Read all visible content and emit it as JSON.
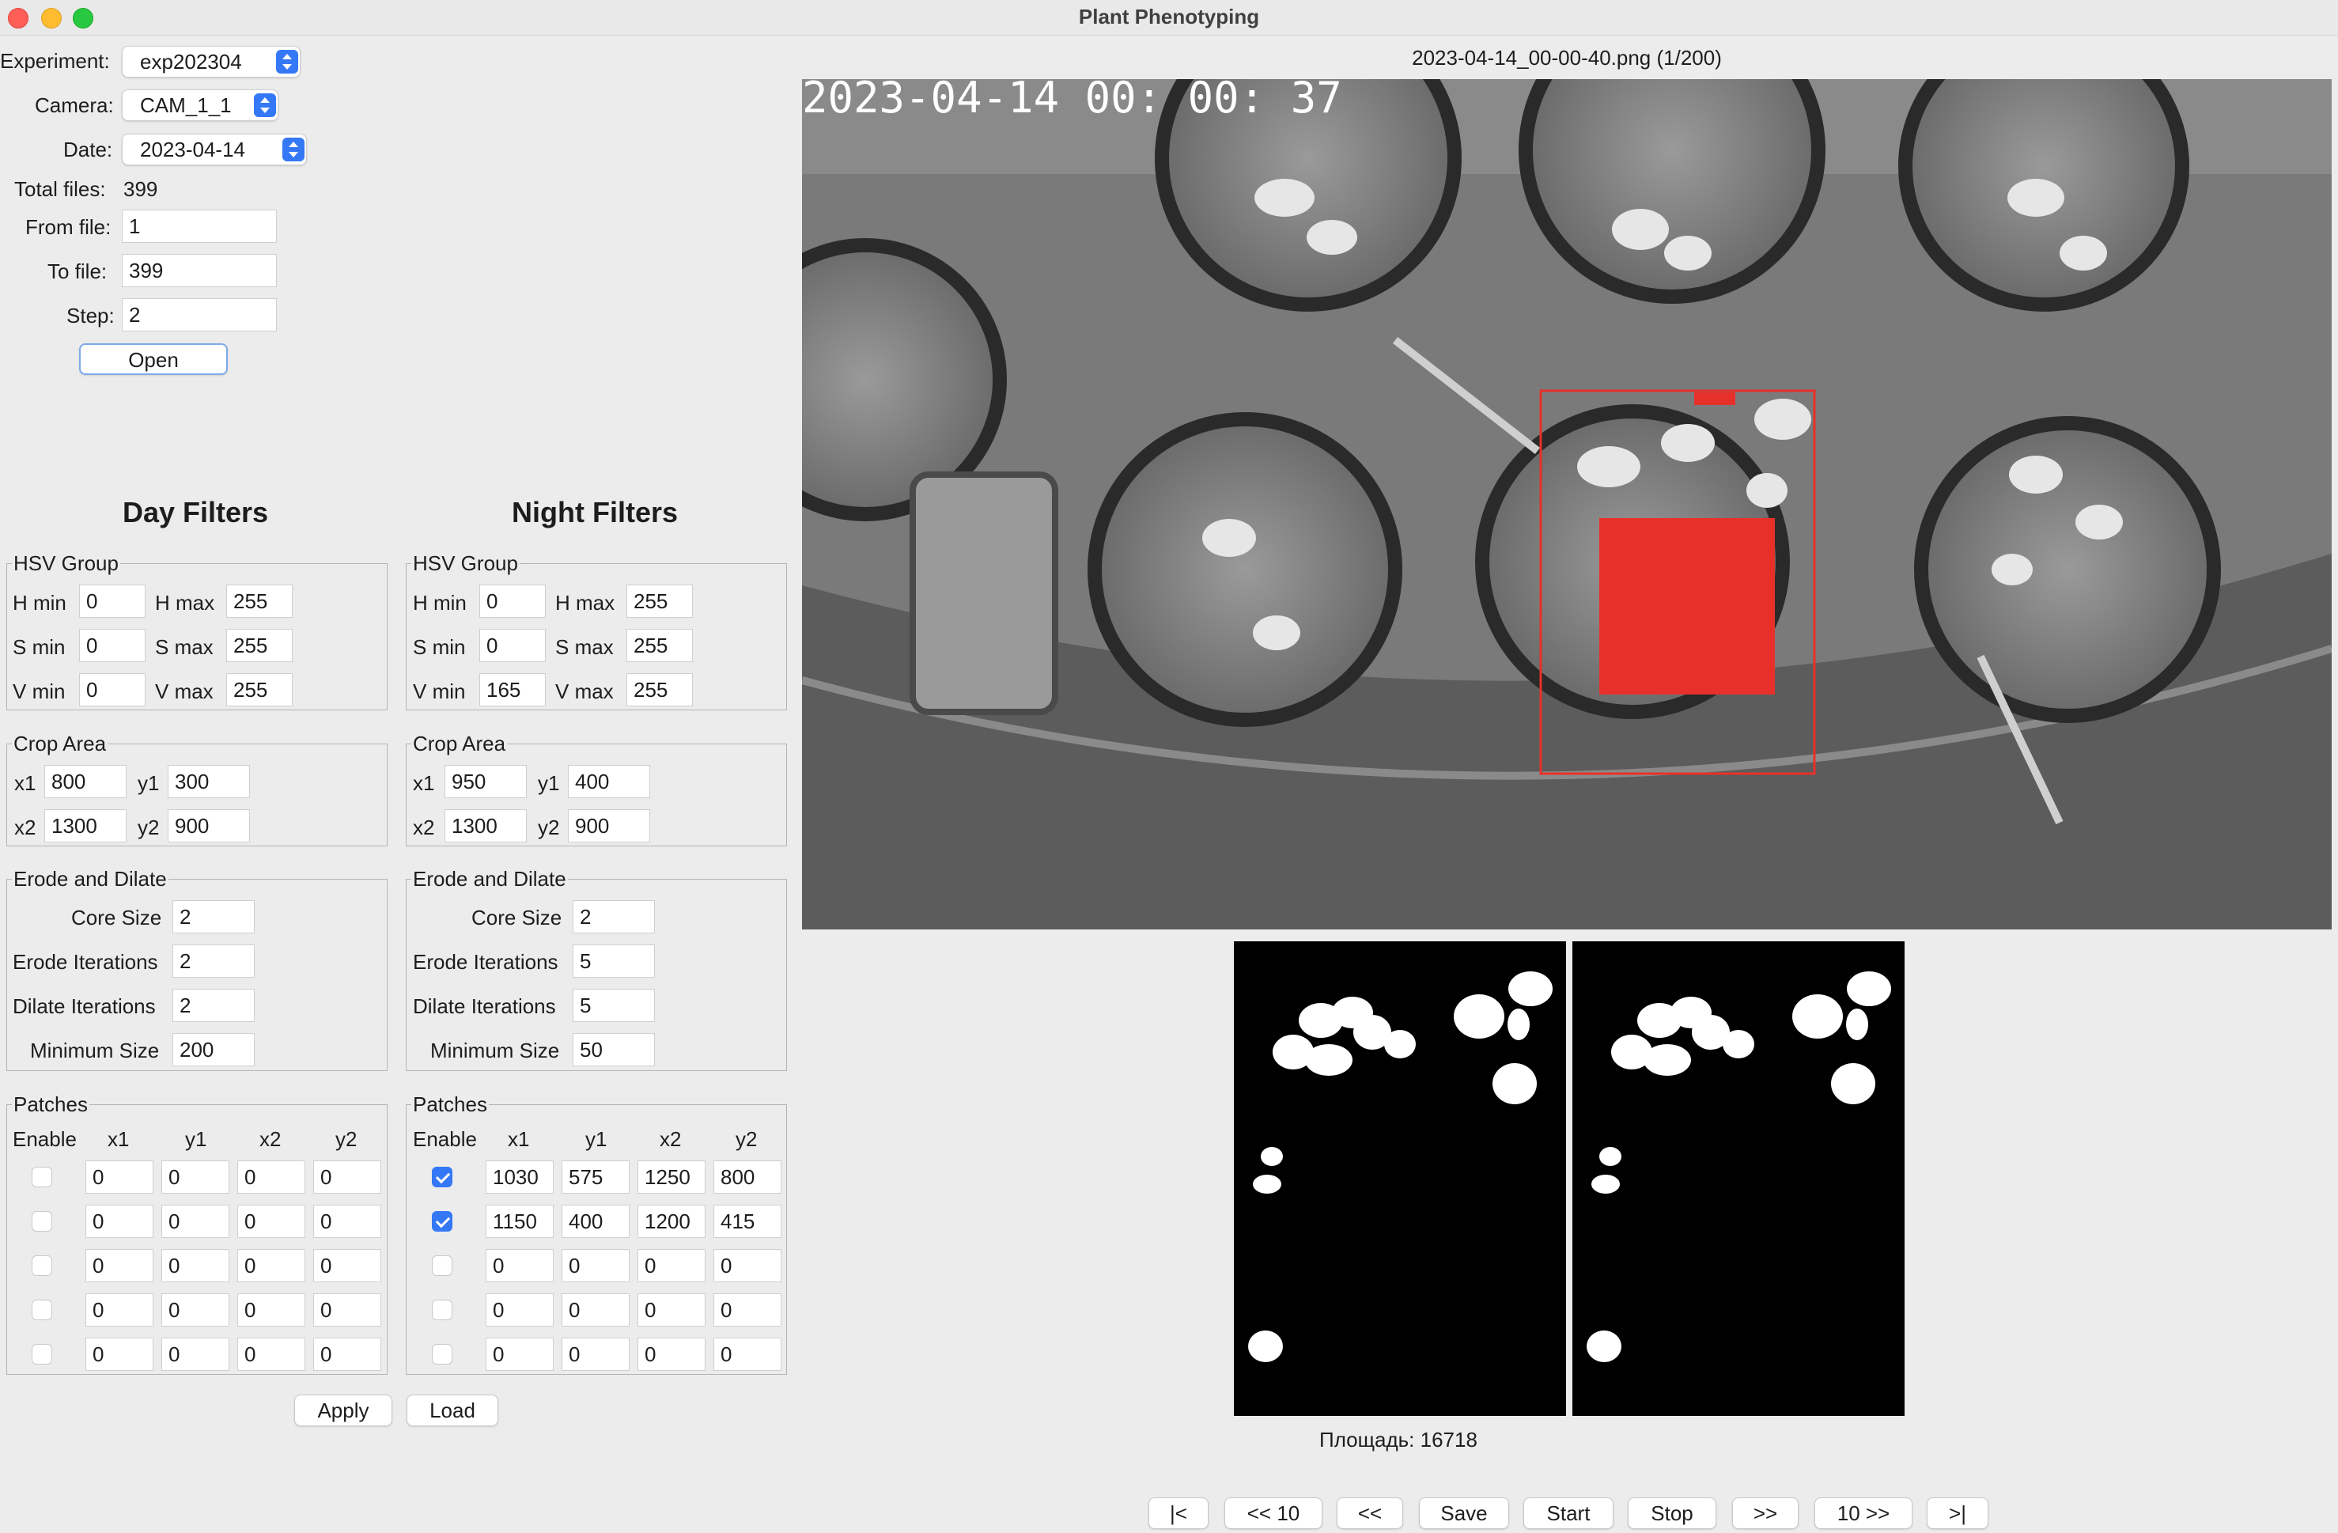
{
  "window": {
    "title": "Plant Phenotyping"
  },
  "source": {
    "experiment_label": "Experiment:",
    "experiment_value": "exp202304",
    "camera_label": "Camera:",
    "camera_value": "CAM_1_1",
    "date_label": "Date:",
    "date_value": "2023-04-14",
    "total_files_label": "Total files:",
    "total_files_value": "399",
    "from_label": "From file:",
    "from_value": "1",
    "to_label": "To file:",
    "to_value": "399",
    "step_label": "Step:",
    "step_value": "2",
    "open_label": "Open"
  },
  "day": {
    "title": "Day Filters",
    "hsv": {
      "title": "HSV Group",
      "h_min_label": "H min",
      "h_min": "0",
      "h_max_label": "H max",
      "h_max": "255",
      "s_min_label": "S min",
      "s_min": "0",
      "s_max_label": "S max",
      "s_max": "255",
      "v_min_label": "V min",
      "v_min": "0",
      "v_max_label": "V max",
      "v_max": "255"
    },
    "crop": {
      "title": "Crop Area",
      "x1_label": "x1",
      "x1": "800",
      "y1_label": "y1",
      "y1": "300",
      "x2_label": "x2",
      "x2": "1300",
      "y2_label": "y2",
      "y2": "900"
    },
    "erode": {
      "title": "Erode and Dilate",
      "core_label": "Core Size",
      "core": "2",
      "erode_label": "Erode Iterations",
      "erode": "2",
      "dilate_label": "Dilate Iterations",
      "dilate": "2",
      "min_label": "Minimum Size",
      "min": "200"
    },
    "patches": {
      "title": "Patches",
      "headers": [
        "Enable",
        "x1",
        "y1",
        "x2",
        "y2"
      ],
      "rows": [
        {
          "enabled": false,
          "x1": "0",
          "y1": "0",
          "x2": "0",
          "y2": "0"
        },
        {
          "enabled": false,
          "x1": "0",
          "y1": "0",
          "x2": "0",
          "y2": "0"
        },
        {
          "enabled": false,
          "x1": "0",
          "y1": "0",
          "x2": "0",
          "y2": "0"
        },
        {
          "enabled": false,
          "x1": "0",
          "y1": "0",
          "x2": "0",
          "y2": "0"
        },
        {
          "enabled": false,
          "x1": "0",
          "y1": "0",
          "x2": "0",
          "y2": "0"
        }
      ]
    }
  },
  "night": {
    "title": "Night Filters",
    "hsv": {
      "title": "HSV Group",
      "h_min_label": "H min",
      "h_min": "0",
      "h_max_label": "H max",
      "h_max": "255",
      "s_min_label": "S min",
      "s_min": "0",
      "s_max_label": "S max",
      "s_max": "255",
      "v_min_label": "V min",
      "v_min": "165",
      "v_max_label": "V max",
      "v_max": "255"
    },
    "crop": {
      "title": "Crop Area",
      "x1_label": "x1",
      "x1": "950",
      "y1_label": "y1",
      "y1": "400",
      "x2_label": "x2",
      "x2": "1300",
      "y2_label": "y2",
      "y2": "900"
    },
    "erode": {
      "title": "Erode and Dilate",
      "core_label": "Core Size",
      "core": "2",
      "erode_label": "Erode Iterations",
      "erode": "5",
      "dilate_label": "Dilate Iterations",
      "dilate": "5",
      "min_label": "Minimum Size",
      "min": "50"
    },
    "patches": {
      "title": "Patches",
      "headers": [
        "Enable",
        "x1",
        "y1",
        "x2",
        "y2"
      ],
      "rows": [
        {
          "enabled": true,
          "x1": "1030",
          "y1": "575",
          "x2": "1250",
          "y2": "800"
        },
        {
          "enabled": true,
          "x1": "1150",
          "y1": "400",
          "x2": "1200",
          "y2": "415"
        },
        {
          "enabled": false,
          "x1": "0",
          "y1": "0",
          "x2": "0",
          "y2": "0"
        },
        {
          "enabled": false,
          "x1": "0",
          "y1": "0",
          "x2": "0",
          "y2": "0"
        },
        {
          "enabled": false,
          "x1": "0",
          "y1": "0",
          "x2": "0",
          "y2": "0"
        }
      ]
    }
  },
  "actions": {
    "apply_label": "Apply",
    "load_label": "Load"
  },
  "viewer": {
    "file_caption": "2023-04-14_00-00-40.png (1/200)",
    "timestamp_overlay": "2023-04-14  00: 00: 37",
    "area_text": "Площадь: 16718",
    "accent_color": "#e8302a"
  },
  "nav": {
    "first": "|<",
    "back10": "<< 10",
    "back": "<<",
    "save": "Save",
    "start": "Start",
    "stop": "Stop",
    "forward": ">>",
    "forward10": "10 >>",
    "last": ">|"
  }
}
